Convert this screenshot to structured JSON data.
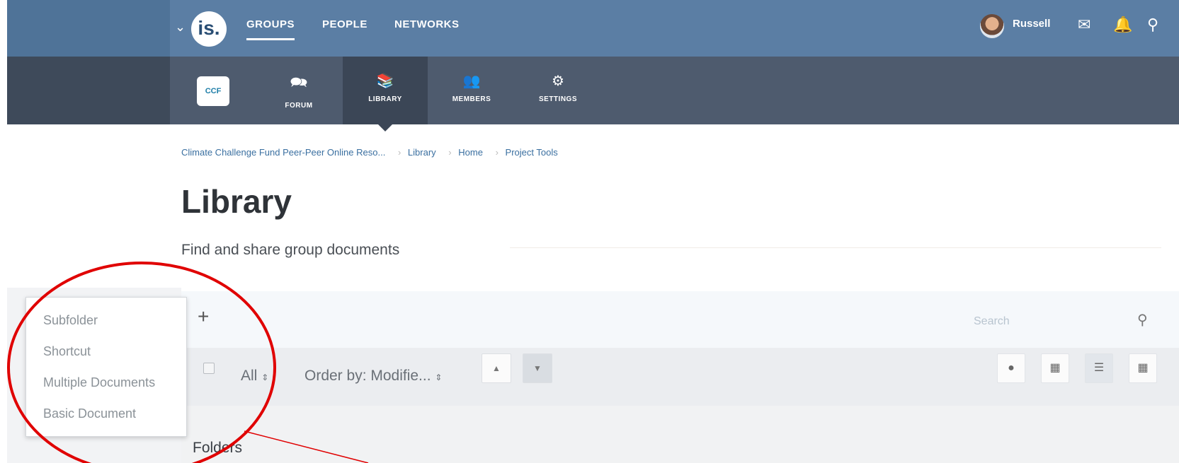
{
  "header": {
    "logo_text": "is.",
    "logo_sub": "",
    "nav": [
      "GROUPS",
      "PEOPLE",
      "NETWORKS"
    ],
    "user_name": "Russell",
    "icons": [
      "chevron-down-icon",
      "mail-icon",
      "bell-icon",
      "search-icon"
    ]
  },
  "group_nav": {
    "logo_text": "CCF",
    "tabs": [
      {
        "label": "FORUM",
        "icon": "forum-icon"
      },
      {
        "label": "LIBRARY",
        "icon": "library-icon"
      },
      {
        "label": "MEMBERS",
        "icon": "members-icon"
      },
      {
        "label": "SETTINGS",
        "icon": "gear-icon"
      }
    ],
    "active_tab": "LIBRARY"
  },
  "breadcrumb": [
    "Climate Challenge Fund Peer-Peer Online Reso...",
    "Library",
    "Home",
    "Project Tools"
  ],
  "page": {
    "title": "Library",
    "subtitle": "Find and share group documents"
  },
  "toolbar": {
    "add_label": "+",
    "search_placeholder": "Search"
  },
  "filterbar": {
    "all_label": "All",
    "order_label": "Order by: Modifie...",
    "sort_up": "▲",
    "sort_down": "▼"
  },
  "add_menu": [
    "Subfolder",
    "Shortcut",
    "Multiple Documents",
    "Basic Document"
  ],
  "content": {
    "section_title": "Folders"
  },
  "colors": {
    "topbar": "#5b7ea4",
    "subbar": "#4e5b6e",
    "annotation": "#e00000"
  }
}
